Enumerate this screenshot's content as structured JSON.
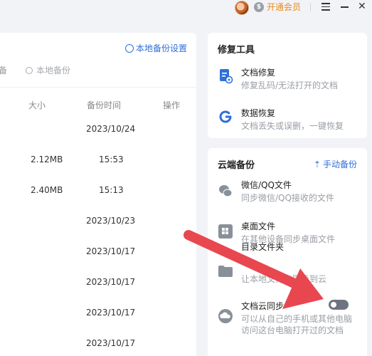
{
  "topbar": {
    "vip_label": "开通会员",
    "vip_badge": "$"
  },
  "left": {
    "local_backup_settings": "本地备份设置",
    "cut_label": "备",
    "search_placeholder": "本地备份",
    "columns": {
      "size": "大小",
      "time": "备份时间",
      "action": "操作"
    },
    "rows": [
      {
        "size": "",
        "time": "2023/10/24"
      },
      {
        "size": "2.12MB",
        "time": "15:53"
      },
      {
        "size": "2.40MB",
        "time": "15:13"
      },
      {
        "size": "",
        "time": "2023/10/23"
      },
      {
        "size": "",
        "time": "2023/10/17"
      },
      {
        "size": "",
        "time": "2023/10/17"
      },
      {
        "size": "",
        "time": "2023/10/17"
      },
      {
        "size": "",
        "time": "2023/10/17"
      }
    ]
  },
  "repair": {
    "title": "修复工具",
    "items": [
      {
        "title": "文档修复",
        "desc": "修复乱码/无法打开的文档",
        "icon": "doc-repair-icon"
      },
      {
        "title": "数据恢复",
        "desc": "文档丢失或误删，一键恢复",
        "icon": "data-recovery-icon"
      }
    ]
  },
  "cloud": {
    "title": "云端备份",
    "manual_backup": "手动备份",
    "items": [
      {
        "title": "微信/QQ文件",
        "desc": "同步微信/QQ接收的文件",
        "icon": "chat-icon"
      },
      {
        "title": "桌面文件",
        "desc": "在其他设备同步桌面文件",
        "icon": "desktop-icon"
      },
      {
        "title": "目录文件夹",
        "desc": "让本地文件夹同步到云",
        "icon": "folder-icon"
      },
      {
        "title": "文档云同步",
        "desc": "可以从自己的手机或其他电脑",
        "desc2": "访问这台电脑打开过的文档",
        "icon": "cloud-sync-icon",
        "toggle": "on"
      }
    ]
  },
  "colors": {
    "accent": "#2f6fd8",
    "vip": "#e98a1f",
    "arrow": "#e8474f"
  }
}
